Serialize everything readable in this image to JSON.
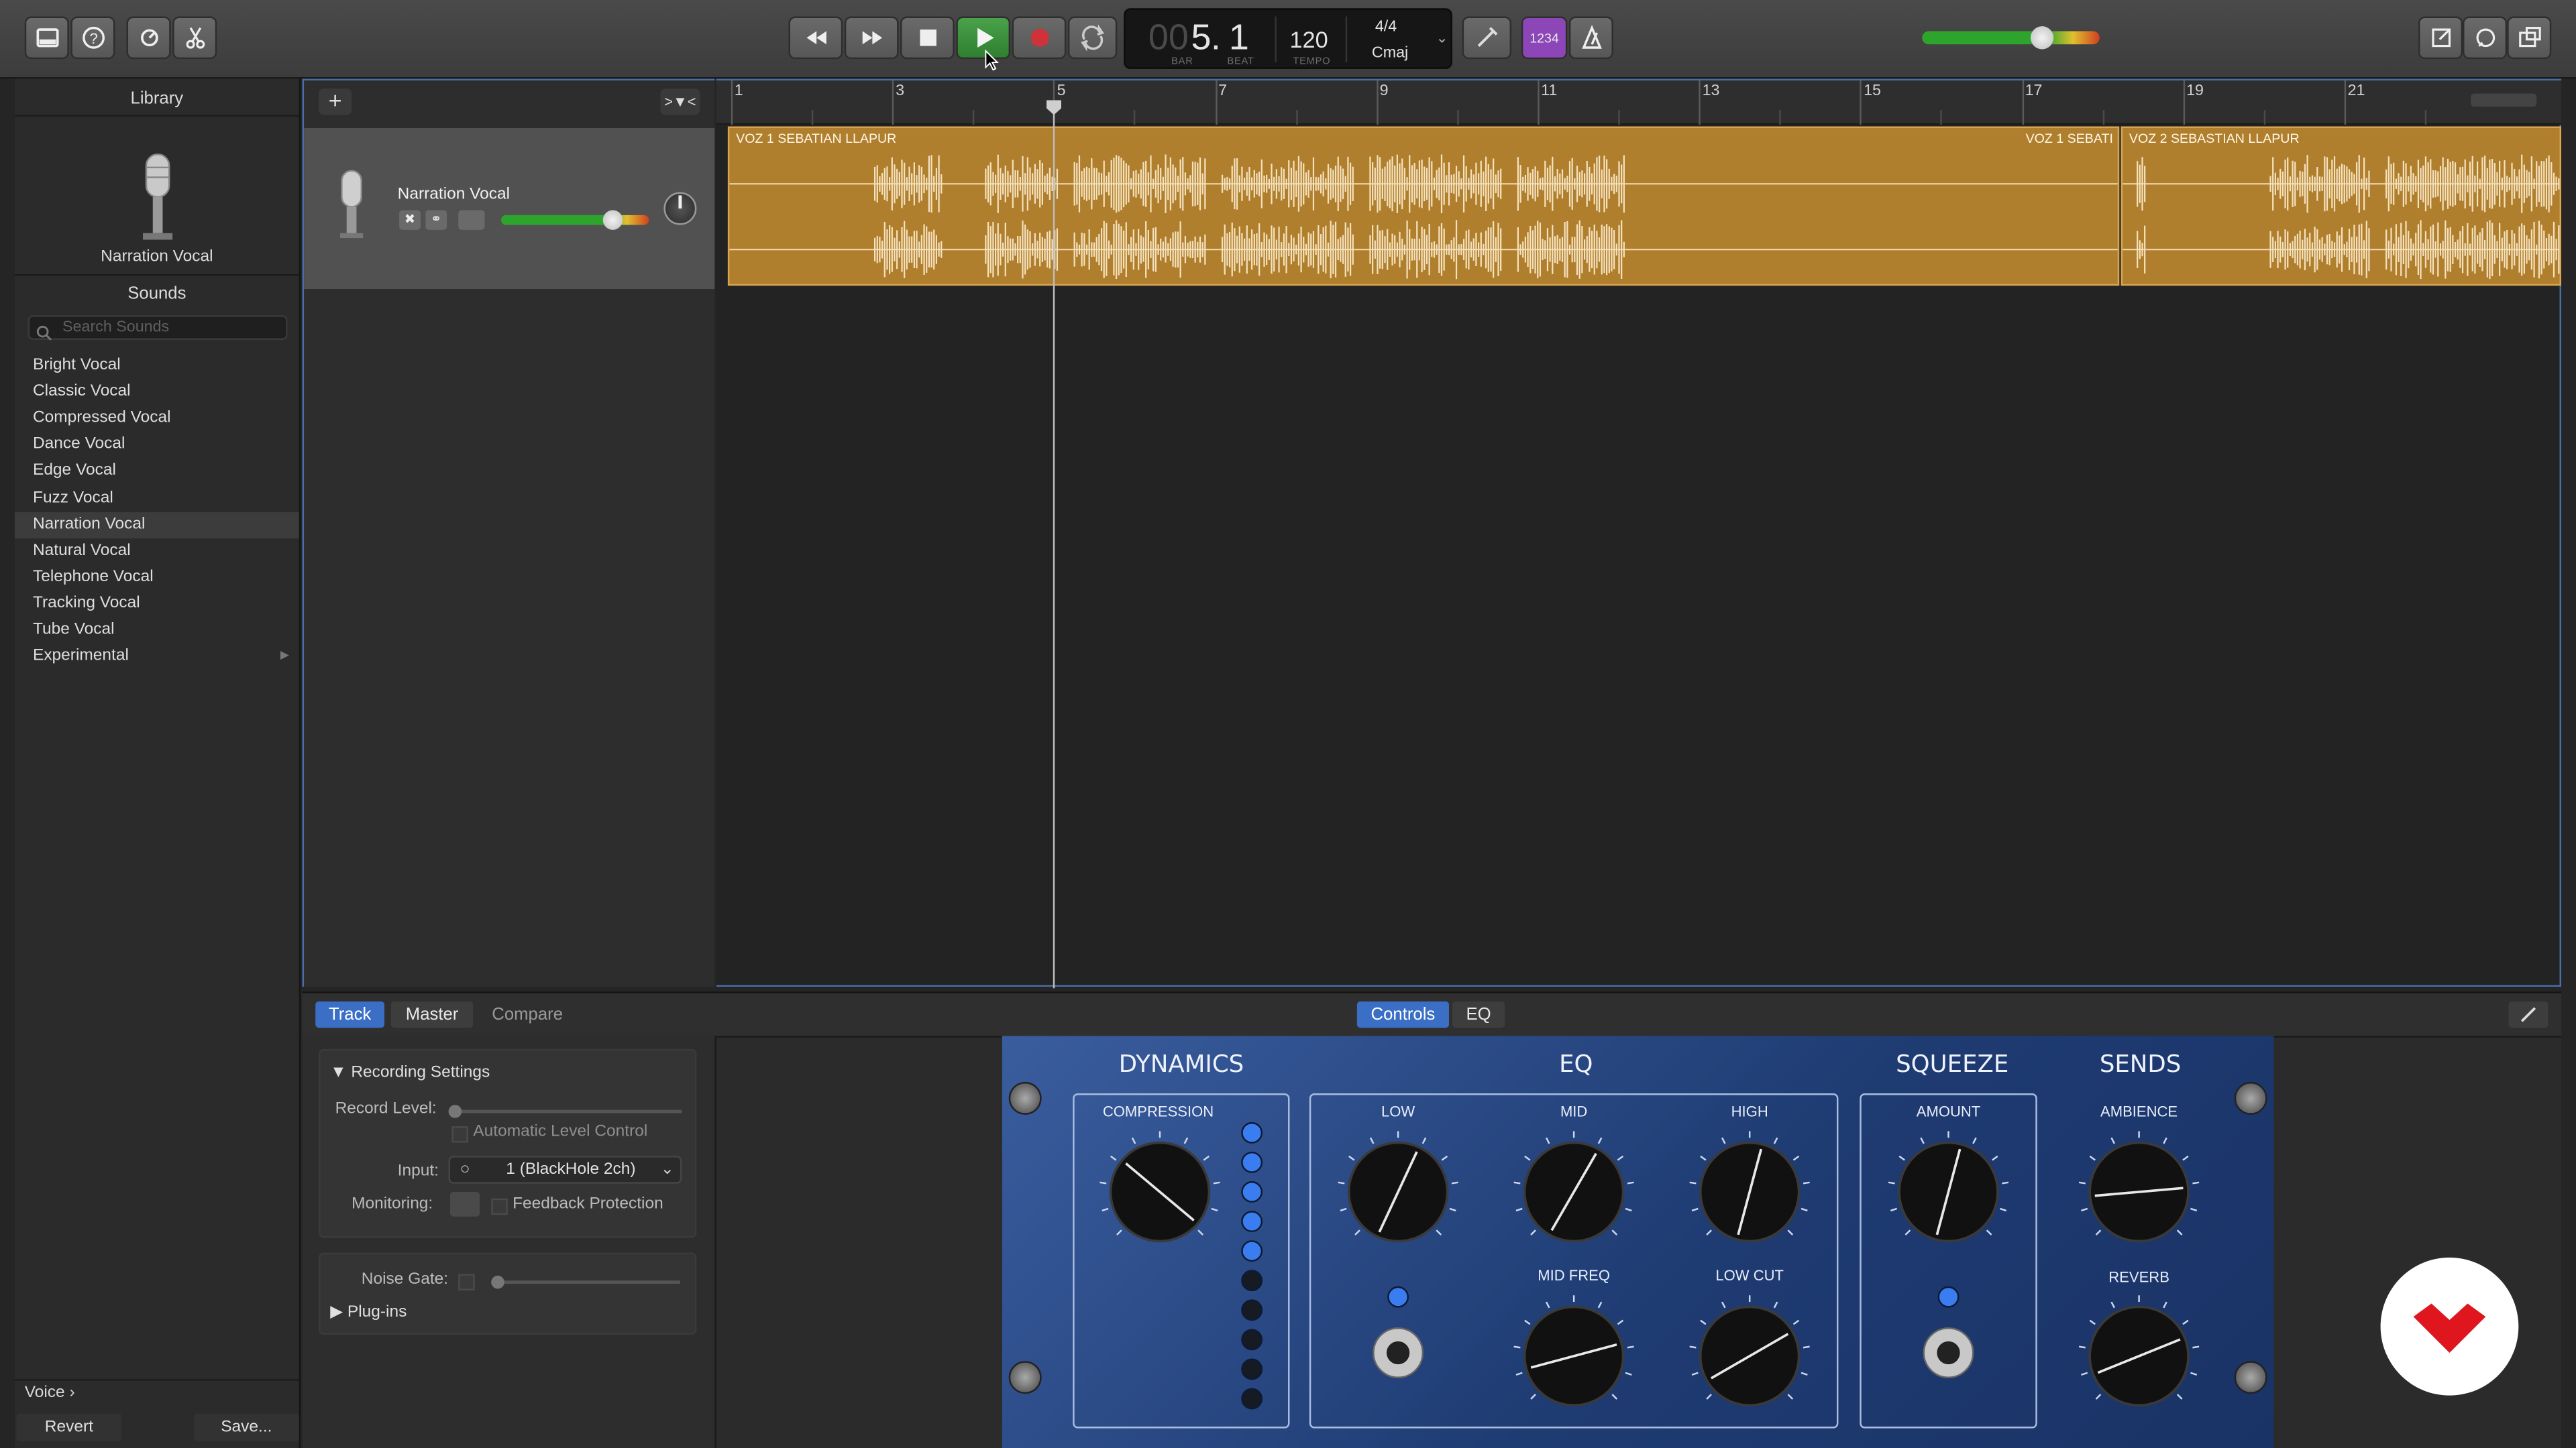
{
  "toolbar": {
    "lcd": {
      "bar": "5",
      "beat": "1",
      "bar_label": "BAR",
      "beat_label": "BEAT",
      "tempo": "120",
      "tempo_label": "TEMPO",
      "time_sig": "4/4",
      "key": "Cmaj"
    },
    "count_in": "1234",
    "master_volume": 0.68
  },
  "library": {
    "title": "Library",
    "patch_name": "Narration Vocal",
    "sounds_title": "Sounds",
    "search_placeholder": "Search Sounds",
    "sounds": [
      "Bright Vocal",
      "Classic Vocal",
      "Compressed Vocal",
      "Dance Vocal",
      "Edge Vocal",
      "Fuzz Vocal",
      "Narration Vocal",
      "Natural Vocal",
      "Telephone Vocal",
      "Tracking Vocal",
      "Tube Vocal",
      "Experimental"
    ],
    "selected_sound": "Narration Vocal",
    "footer_breadcrumb": "Voice",
    "revert_label": "Revert",
    "save_label": "Save..."
  },
  "track": {
    "name": "Narration Vocal",
    "volume": 0.75
  },
  "ruler": {
    "bars": [
      "1",
      "3",
      "5",
      "7",
      "9",
      "11",
      "13",
      "15",
      "17",
      "19",
      "21"
    ]
  },
  "regions": [
    {
      "title": "VOZ 1 SEBATIAN LLAPUR",
      "title_right": "VOZ 1 SEBATI"
    },
    {
      "title": "VOZ 2 SEBASTIAN LLAPUR"
    }
  ],
  "smart_controls": {
    "tabs": [
      "Track",
      "Master",
      "Compare"
    ],
    "view_tabs": [
      "Controls",
      "EQ"
    ],
    "recording_settings": "Recording Settings",
    "record_level_label": "Record Level:",
    "alc_label": "Automatic Level Control",
    "input_label": "Input:",
    "input_value": "1 (BlackHole 2ch)",
    "monitoring_label": "Monitoring:",
    "feedback_label": "Feedback Protection",
    "noise_gate_label": "Noise Gate:",
    "plugins_label": "Plug-ins"
  },
  "plugin": {
    "dynamics": "DYNAMICS",
    "eq": "EQ",
    "squeeze": "SQUEEZE",
    "sends": "SENDS",
    "compression": "COMPRESSION",
    "low": "LOW",
    "mid": "MID",
    "high": "HIGH",
    "mid_freq": "MID FREQ",
    "low_cut": "LOW CUT",
    "amount": "AMOUNT",
    "ambience": "AMBIENCE",
    "reverb": "REVERB"
  },
  "colors": {
    "accent_blue": "#3b6fc6",
    "region": "#b07f2e",
    "play_green": "#3a8a3a",
    "record_red": "#d0323a"
  }
}
